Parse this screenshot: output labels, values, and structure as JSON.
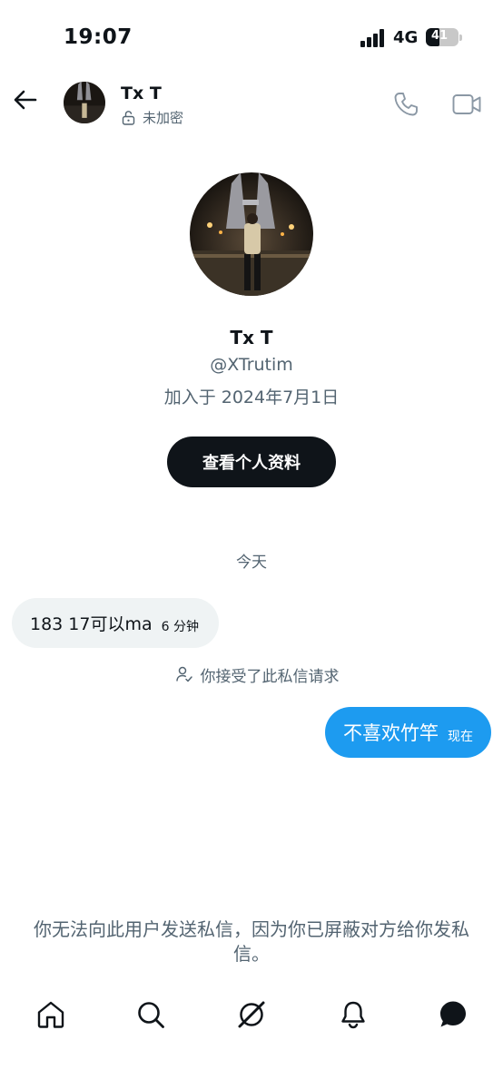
{
  "status_bar": {
    "time": "19:07",
    "network": "4G",
    "battery_level": "41",
    "battery_fraction": 0.41
  },
  "header": {
    "back_icon": "arrow-left-icon",
    "name": "Tx T",
    "encryption_icon": "unlock-icon",
    "encryption_status": "未加密",
    "call_icon": "phone-icon",
    "video_icon": "video-camera-icon"
  },
  "profile": {
    "name": "Tx T",
    "handle": "@XTrutim",
    "joined": "加入于 2024年7月1日",
    "view_profile_label": "查看个人资料"
  },
  "conversation": {
    "date_label": "今天",
    "messages": [
      {
        "direction": "incoming",
        "text": "183  17可以ma",
        "time": "6 分钟"
      },
      {
        "direction": "outgoing",
        "text": "不喜欢竹竿",
        "time": "现在"
      }
    ],
    "system_event": {
      "icon": "person-check-icon",
      "text": "你接受了此私信请求"
    }
  },
  "blocked_notice": "你无法向此用户发送私信，因为你已屏蔽对方给你发私信。",
  "bottom_nav": [
    {
      "icon": "home-icon"
    },
    {
      "icon": "search-icon"
    },
    {
      "icon": "grok-icon"
    },
    {
      "icon": "bell-icon"
    },
    {
      "icon": "messages-icon",
      "active": true
    }
  ],
  "colors": {
    "accent": "#1d9bf0",
    "text_primary": "#0f1419",
    "text_secondary": "#536471",
    "incoming_bubble": "#eff3f4",
    "button_dark": "#0f1419"
  }
}
